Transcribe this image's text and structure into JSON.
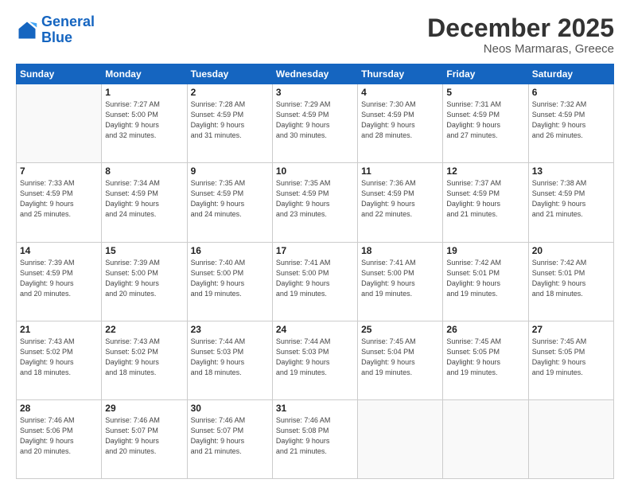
{
  "header": {
    "logo_line1": "General",
    "logo_line2": "Blue",
    "title": "December 2025",
    "subtitle": "Neos Marmaras, Greece"
  },
  "days_of_week": [
    "Sunday",
    "Monday",
    "Tuesday",
    "Wednesday",
    "Thursday",
    "Friday",
    "Saturday"
  ],
  "weeks": [
    [
      {
        "day": "",
        "info": ""
      },
      {
        "day": "1",
        "info": "Sunrise: 7:27 AM\nSunset: 5:00 PM\nDaylight: 9 hours\nand 32 minutes."
      },
      {
        "day": "2",
        "info": "Sunrise: 7:28 AM\nSunset: 4:59 PM\nDaylight: 9 hours\nand 31 minutes."
      },
      {
        "day": "3",
        "info": "Sunrise: 7:29 AM\nSunset: 4:59 PM\nDaylight: 9 hours\nand 30 minutes."
      },
      {
        "day": "4",
        "info": "Sunrise: 7:30 AM\nSunset: 4:59 PM\nDaylight: 9 hours\nand 28 minutes."
      },
      {
        "day": "5",
        "info": "Sunrise: 7:31 AM\nSunset: 4:59 PM\nDaylight: 9 hours\nand 27 minutes."
      },
      {
        "day": "6",
        "info": "Sunrise: 7:32 AM\nSunset: 4:59 PM\nDaylight: 9 hours\nand 26 minutes."
      }
    ],
    [
      {
        "day": "7",
        "info": "Sunrise: 7:33 AM\nSunset: 4:59 PM\nDaylight: 9 hours\nand 25 minutes."
      },
      {
        "day": "8",
        "info": "Sunrise: 7:34 AM\nSunset: 4:59 PM\nDaylight: 9 hours\nand 24 minutes."
      },
      {
        "day": "9",
        "info": "Sunrise: 7:35 AM\nSunset: 4:59 PM\nDaylight: 9 hours\nand 24 minutes."
      },
      {
        "day": "10",
        "info": "Sunrise: 7:35 AM\nSunset: 4:59 PM\nDaylight: 9 hours\nand 23 minutes."
      },
      {
        "day": "11",
        "info": "Sunrise: 7:36 AM\nSunset: 4:59 PM\nDaylight: 9 hours\nand 22 minutes."
      },
      {
        "day": "12",
        "info": "Sunrise: 7:37 AM\nSunset: 4:59 PM\nDaylight: 9 hours\nand 21 minutes."
      },
      {
        "day": "13",
        "info": "Sunrise: 7:38 AM\nSunset: 4:59 PM\nDaylight: 9 hours\nand 21 minutes."
      }
    ],
    [
      {
        "day": "14",
        "info": "Sunrise: 7:39 AM\nSunset: 4:59 PM\nDaylight: 9 hours\nand 20 minutes."
      },
      {
        "day": "15",
        "info": "Sunrise: 7:39 AM\nSunset: 5:00 PM\nDaylight: 9 hours\nand 20 minutes."
      },
      {
        "day": "16",
        "info": "Sunrise: 7:40 AM\nSunset: 5:00 PM\nDaylight: 9 hours\nand 19 minutes."
      },
      {
        "day": "17",
        "info": "Sunrise: 7:41 AM\nSunset: 5:00 PM\nDaylight: 9 hours\nand 19 minutes."
      },
      {
        "day": "18",
        "info": "Sunrise: 7:41 AM\nSunset: 5:00 PM\nDaylight: 9 hours\nand 19 minutes."
      },
      {
        "day": "19",
        "info": "Sunrise: 7:42 AM\nSunset: 5:01 PM\nDaylight: 9 hours\nand 19 minutes."
      },
      {
        "day": "20",
        "info": "Sunrise: 7:42 AM\nSunset: 5:01 PM\nDaylight: 9 hours\nand 18 minutes."
      }
    ],
    [
      {
        "day": "21",
        "info": "Sunrise: 7:43 AM\nSunset: 5:02 PM\nDaylight: 9 hours\nand 18 minutes."
      },
      {
        "day": "22",
        "info": "Sunrise: 7:43 AM\nSunset: 5:02 PM\nDaylight: 9 hours\nand 18 minutes."
      },
      {
        "day": "23",
        "info": "Sunrise: 7:44 AM\nSunset: 5:03 PM\nDaylight: 9 hours\nand 18 minutes."
      },
      {
        "day": "24",
        "info": "Sunrise: 7:44 AM\nSunset: 5:03 PM\nDaylight: 9 hours\nand 19 minutes."
      },
      {
        "day": "25",
        "info": "Sunrise: 7:45 AM\nSunset: 5:04 PM\nDaylight: 9 hours\nand 19 minutes."
      },
      {
        "day": "26",
        "info": "Sunrise: 7:45 AM\nSunset: 5:05 PM\nDaylight: 9 hours\nand 19 minutes."
      },
      {
        "day": "27",
        "info": "Sunrise: 7:45 AM\nSunset: 5:05 PM\nDaylight: 9 hours\nand 19 minutes."
      }
    ],
    [
      {
        "day": "28",
        "info": "Sunrise: 7:46 AM\nSunset: 5:06 PM\nDaylight: 9 hours\nand 20 minutes."
      },
      {
        "day": "29",
        "info": "Sunrise: 7:46 AM\nSunset: 5:07 PM\nDaylight: 9 hours\nand 20 minutes."
      },
      {
        "day": "30",
        "info": "Sunrise: 7:46 AM\nSunset: 5:07 PM\nDaylight: 9 hours\nand 21 minutes."
      },
      {
        "day": "31",
        "info": "Sunrise: 7:46 AM\nSunset: 5:08 PM\nDaylight: 9 hours\nand 21 minutes."
      },
      {
        "day": "",
        "info": ""
      },
      {
        "day": "",
        "info": ""
      },
      {
        "day": "",
        "info": ""
      }
    ]
  ]
}
